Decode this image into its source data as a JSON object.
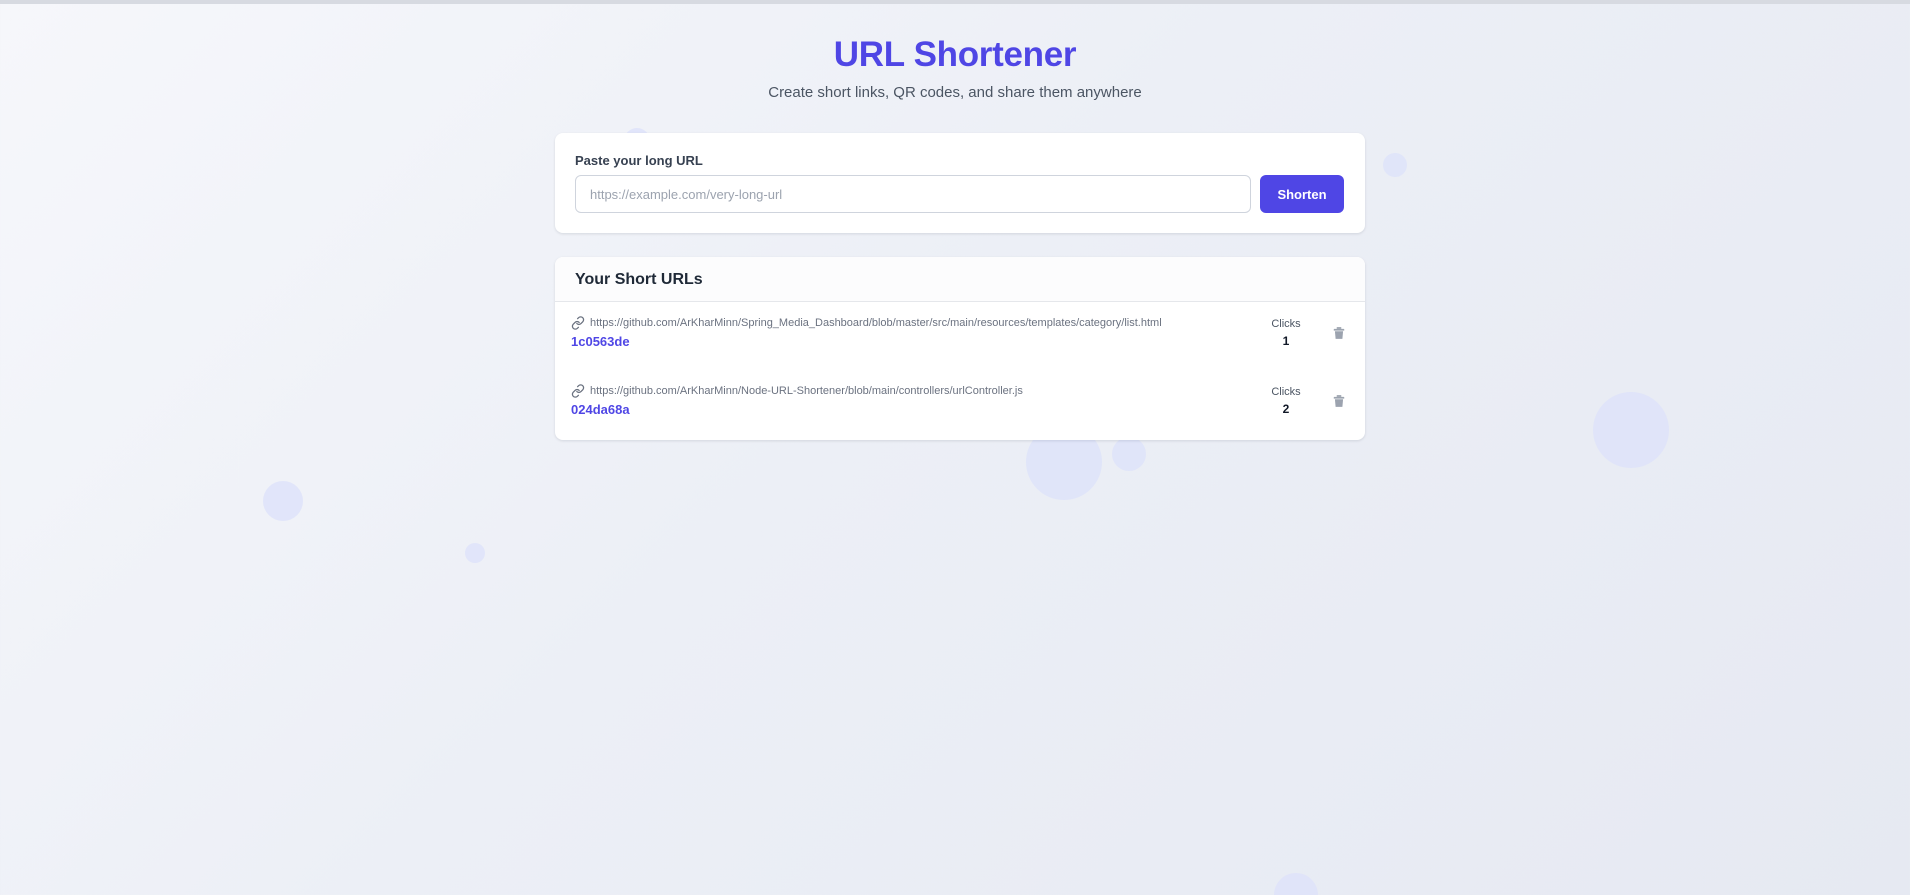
{
  "header": {
    "title": "URL Shortener",
    "subtitle": "Create short links, QR codes, and share them anywhere"
  },
  "form": {
    "label": "Paste your long URL",
    "placeholder": "https://example.com/very-long-url",
    "value": "",
    "submit_label": "Shorten"
  },
  "list": {
    "title": "Your Short URLs",
    "items": [
      {
        "original_url": "https://github.com/ArKharMinn/Spring_Media_Dashboard/blob/master/src/main/resources/templates/category/list.html",
        "short_code": "1c0563de",
        "clicks_label": "Clicks",
        "clicks": "1"
      },
      {
        "original_url": "https://github.com/ArKharMinn/Node-URL-Shortener/blob/main/controllers/urlController.js",
        "short_code": "024da68a",
        "clicks_label": "Clicks",
        "clicks": "2"
      }
    ]
  },
  "icons": {
    "link": "link-icon",
    "delete": "trash-icon"
  },
  "colors": {
    "accent": "#4f46e5",
    "background": "#eef0f6",
    "card": "#ffffff",
    "muted_text": "#6b7280"
  }
}
